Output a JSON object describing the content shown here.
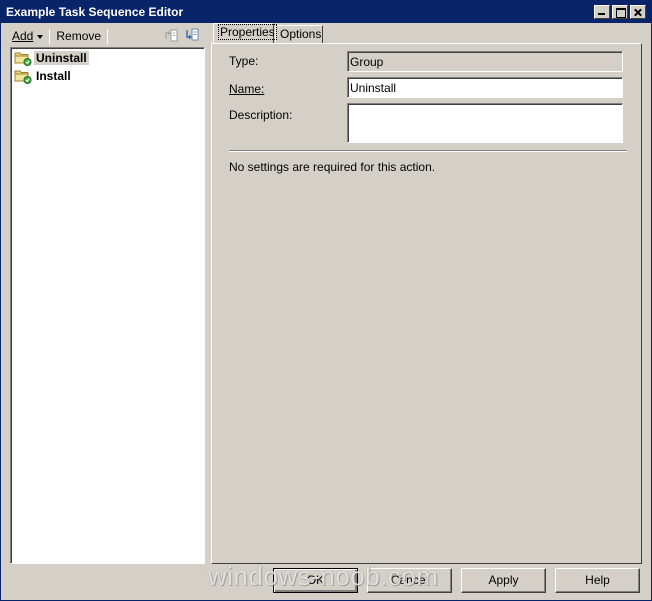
{
  "window": {
    "title": "Example Task Sequence Editor",
    "titlebar_color": "#0a246a",
    "controls": [
      "minimize-icon",
      "maximize-icon",
      "close-icon"
    ]
  },
  "toolbar": {
    "add_label": "Add",
    "remove_label": "Remove",
    "icons": [
      "move-up-icon",
      "move-down-icon"
    ]
  },
  "tree": {
    "items": [
      {
        "label": "Uninstall",
        "icon": "group-folder-icon",
        "selected": true
      },
      {
        "label": "Install",
        "icon": "group-folder-icon",
        "selected": false
      }
    ]
  },
  "tabs": [
    {
      "label": "Properties",
      "active": true
    },
    {
      "label": "Options",
      "active": false
    }
  ],
  "properties": {
    "type_label": "Type:",
    "type_value": "Group",
    "name_label": "Name:",
    "name_value": "Uninstall",
    "description_label": "Description:",
    "description_value": "",
    "note": "No settings are required  for this action."
  },
  "buttons": {
    "ok": "OK",
    "cancel": "Cancel",
    "apply": "Apply",
    "help": "Help"
  },
  "watermark": "windows-noob.com"
}
